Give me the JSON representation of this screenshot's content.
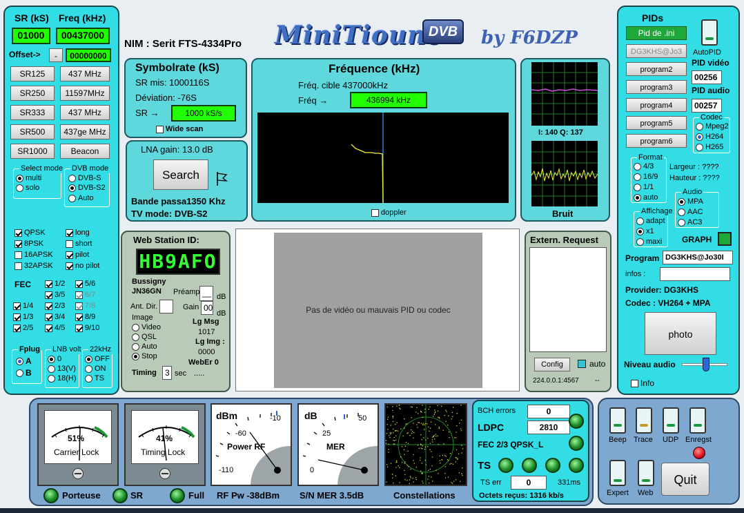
{
  "left": {
    "sr_label": "SR (kS)",
    "freq_label": "Freq (kHz)",
    "sr_value": "01000",
    "freq_value": "00437000",
    "offset_label": "Offset->",
    "offset_sign": "-",
    "offset_value": "00000000",
    "sr_buttons": [
      "SR125",
      "SR250",
      "SR333",
      "SR500",
      "SR1000"
    ],
    "freq_buttons": [
      "437 MHz",
      "11597MHz",
      "437 MHz",
      "437ge MHz",
      "Beacon"
    ],
    "select_mode": {
      "title": "Select mode",
      "options": [
        "multi",
        "solo"
      ]
    },
    "dvb_mode": {
      "title": "DVB mode",
      "options": [
        "DVB-S",
        "DVB-S2",
        "Auto"
      ]
    },
    "mod_left": [
      "QPSK",
      "8PSK",
      "16APSK",
      "32APSK"
    ],
    "mod_right": [
      "long",
      "short",
      "pilot",
      "no pilot"
    ],
    "fec_label": "FEC",
    "fec_a": [
      "1/4",
      "1/3",
      "2/5"
    ],
    "fec_b": [
      "1/2",
      "3/5",
      "2/3",
      "3/4",
      "4/5"
    ],
    "fec_c": [
      "5/6",
      "6/7",
      "7/8",
      "8/9",
      "9/10"
    ],
    "fplug": {
      "title": "Fplug",
      "options": [
        "A",
        "B"
      ]
    },
    "lnb": {
      "title": "LNB volt",
      "options": [
        "0",
        "13(V)",
        "18(H)"
      ]
    },
    "k22": {
      "title": "22kHz",
      "options": [
        "OFF",
        "ON",
        "TS"
      ]
    }
  },
  "header": {
    "nim": "NIM : Serit FTS-4334Pro",
    "logo": "MiniTioune",
    "logo_badge": "DVB",
    "author": "by F6DZP"
  },
  "symbolrate": {
    "title": "Symbolrate (kS)",
    "sr_mis": "SR mis: 1000116S",
    "deviation": "Déviation: -76S",
    "sr_arrow": "SR →",
    "sr_value": "1000 kS/s",
    "wide_scan": "Wide scan"
  },
  "lna": {
    "gain": "LNA gain: 13.0 dB",
    "search": "Search",
    "bande": "Bande passa1350 Khz",
    "tv_mode": "TV mode: DVB-S2"
  },
  "frequence": {
    "title": "Fréquence (kHz)",
    "cible": "Fréq. cible   437000kHz",
    "freq_arrow": "Fréq →",
    "freq_value": "436994 kHz",
    "doppler": "doppler"
  },
  "iq": {
    "label": "I:  140  Q:  137",
    "bruit": "Bruit"
  },
  "pids": {
    "title": "PIDs",
    "pid_ini": "Pid de .ini",
    "callsign_btn": "DG3KHS@Jo3",
    "programs": [
      "program2",
      "program3",
      "program4",
      "program5",
      "program6"
    ],
    "autopid": "AutoPID",
    "pid_video_label": "PID vidéo",
    "pid_video": "00256",
    "pid_audio_label": "PID audio",
    "pid_audio": "00257",
    "codec": {
      "title": "Codec",
      "options": [
        "Mpeg2",
        "H264",
        "H265"
      ]
    },
    "format": {
      "title": "Format",
      "options": [
        "4/3",
        "16/9",
        "1/1",
        "auto"
      ]
    },
    "largeur": "Largeur :  ????",
    "hauteur": "Hauteur :  ????",
    "affichage": {
      "title": "Affichage",
      "options": [
        "adapt",
        "x1",
        "maxi"
      ]
    },
    "audio": {
      "title": "Audio",
      "options": [
        "MPA",
        "AAC",
        "AC3"
      ]
    },
    "graph": "GRAPH",
    "program_label": "Program",
    "program_value": "DG3KHS@Jo30I",
    "infos_label": "infos :",
    "provider": "Provider:    DG3KHS",
    "codec_line": "Codec :   VH264 + MPA",
    "photo": "photo",
    "niveau": "Niveau audio",
    "info": "Info"
  },
  "web": {
    "title": "Web Station ID:",
    "station_display": "HB9AFO",
    "city": "Bussigny",
    "locator": "JN36GN",
    "preamp": "Préamp",
    "preamp_val": "__",
    "db1": "dB",
    "ant_dir": "Ant. Dir.",
    "gain": "Gain",
    "gain_val": "00",
    "db2": "dB",
    "image": {
      "title": "Image",
      "options": [
        "Video",
        "QSL",
        "Auto",
        "Stop"
      ]
    },
    "lg_msg": "Lg Msg",
    "lg_msg_val": "1017",
    "lg_img": "Lg Img :",
    "lg_img_val": "0000",
    "weber": "WebEr  0",
    "timing": "Timing",
    "timing_val": "3",
    "sec": "sec",
    "dots": "....."
  },
  "video": {
    "message": "Pas de vidéo ou mauvais PID ou codec"
  },
  "extern": {
    "title": "Extern. Request",
    "config": "Config",
    "auto": "auto",
    "addr": "224.0.0.1:4567",
    "dash": "--"
  },
  "meters": {
    "carrier": {
      "value": "51%",
      "label": "Carrier Lock",
      "fraction": 0.51
    },
    "timing": {
      "value": "41%",
      "label": "Timing Lock",
      "fraction": 0.41
    },
    "power": {
      "unit": "dBm",
      "ticks": [
        "-60",
        "-10",
        "-110"
      ],
      "label": "Power RF"
    },
    "mer": {
      "unit": "dB",
      "ticks": [
        "25",
        "50",
        "0"
      ],
      "label": "MER"
    },
    "constellations": "Constellations"
  },
  "status_bar": {
    "porteuse": "Porteuse",
    "sr": "SR",
    "full": "Full",
    "rf_pw": "RF Pw -38dBm",
    "sn_mer": "S/N MER 3.5dB"
  },
  "bch": {
    "errors_label": "BCH errors",
    "errors_val": "0",
    "ldpc_label": "LDPC",
    "ldpc_val": "2810",
    "fec": "FEC  2/3 QPSK_L",
    "ts": "TS",
    "ts_err_label": "TS err",
    "ts_err_val": "0",
    "ms": "331ms",
    "octets": "Octets reçus: 1316 kb/s"
  },
  "toggles": {
    "labels": [
      "Beep",
      "Trace",
      "UDP",
      "Enregst",
      "Expert",
      "Web"
    ],
    "quit": "Quit"
  }
}
